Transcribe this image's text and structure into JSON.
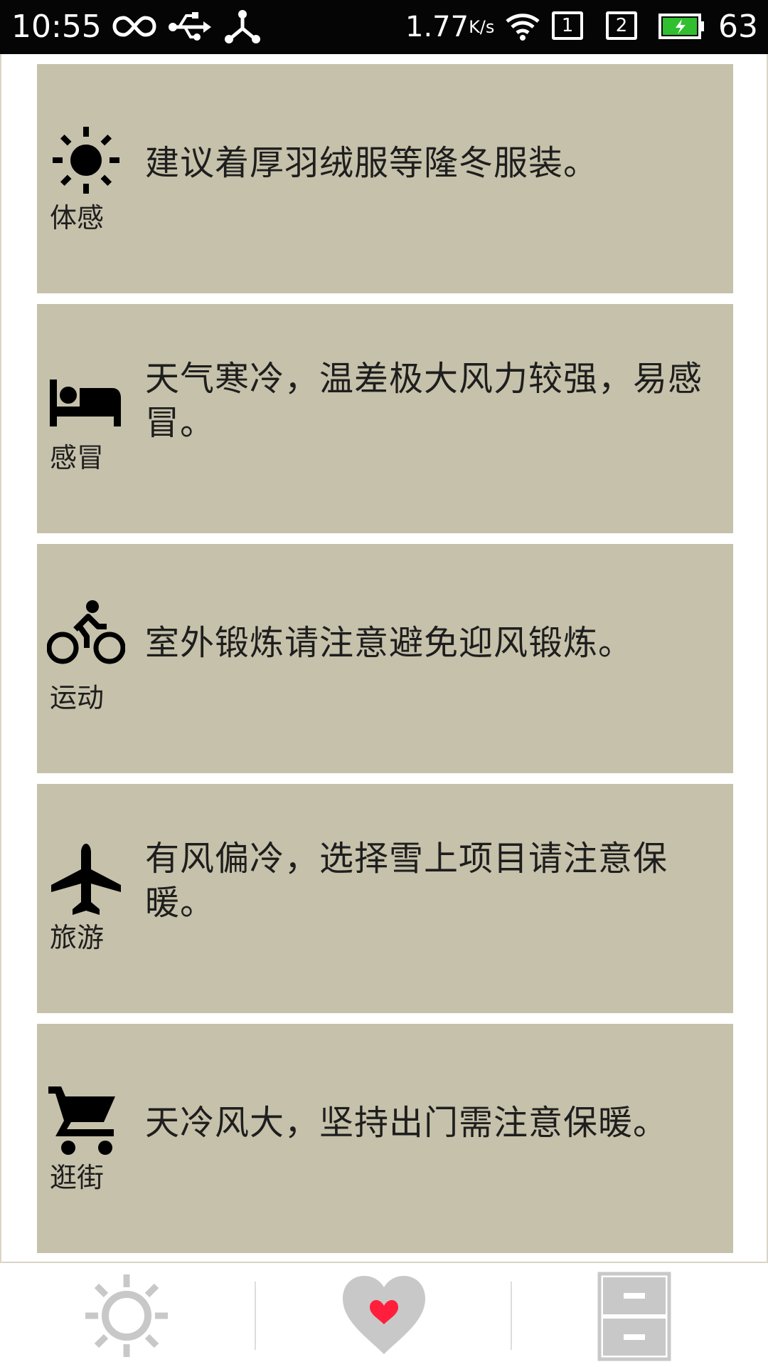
{
  "status_bar": {
    "time": "10:55",
    "network_speed": "1.77",
    "network_speed_unit": "K/s",
    "sim1": "1",
    "sim2": "2",
    "battery_percent": "63",
    "icons": [
      "infinity-icon",
      "usb-icon",
      "share-icon",
      "wifi-icon",
      "sim-1-icon",
      "sim-2-icon",
      "battery-charging-icon"
    ]
  },
  "cards": [
    {
      "icon": "sun-icon",
      "caption": "体感",
      "text": "建议着厚羽绒服等隆冬服装。"
    },
    {
      "icon": "bed-icon",
      "caption": "感冒",
      "text": "天气寒冷，温差极大风力较强，易感冒。"
    },
    {
      "icon": "bicycle-icon",
      "caption": "运动",
      "text": "室外锻炼请注意避免迎风锻炼。"
    },
    {
      "icon": "airplane-icon",
      "caption": "旅游",
      "text": "有风偏冷，选择雪上项目请注意保暖。"
    },
    {
      "icon": "shopping-cart-icon",
      "caption": "逛街",
      "text": "天冷风大，坚持出门需注意保暖。"
    }
  ],
  "bottom_nav": {
    "items": [
      "weather-sun-icon",
      "favorite-heart-icon",
      "file-cabinet-icon"
    ],
    "colors": {
      "inactive": "#c8c8c8",
      "heart_accent": "#ff1f3d"
    }
  },
  "colors": {
    "status_bar_bg": "#050505",
    "card_bg": "#c6c1aa",
    "text": "#1e1e1e",
    "battery_fill": "#2fbf2f"
  }
}
